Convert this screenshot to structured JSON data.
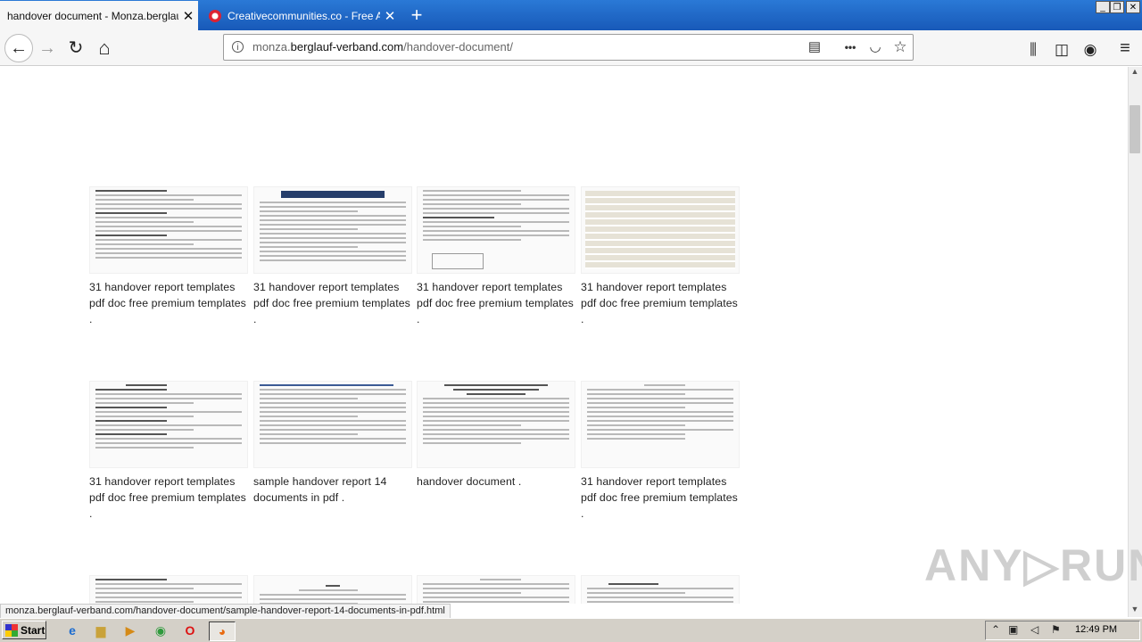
{
  "tabs": [
    {
      "title": "handover document - Monza.berglauf-",
      "close": "✕"
    },
    {
      "title": "Creativecommunities.co - Free All",
      "close": "✕"
    }
  ],
  "new_tab_label": "+",
  "window_controls": [
    "_",
    "❐",
    "✕"
  ],
  "nav": {
    "back": "←",
    "forward": "→",
    "reload": "↻",
    "home": "⌂"
  },
  "url": {
    "prefix": "monza.",
    "host": "berglauf-verband.com",
    "path": "/handover-document/"
  },
  "url_icons": {
    "reader": "▤",
    "more": "•••",
    "pocket": "◡",
    "bookmark": "☆"
  },
  "toolbar_icons": {
    "library": "⫼",
    "sidebar": "◫",
    "account": "◉",
    "menu": "≡"
  },
  "cards": [
    {
      "caption": "31 handover report templates pdf doc free premium templates ."
    },
    {
      "caption": "31 handover report templates pdf doc free premium templates ."
    },
    {
      "caption": "31 handover report templates pdf doc free premium templates ."
    },
    {
      "caption": "31 handover report templates pdf doc free premium templates ."
    },
    {
      "caption": "31 handover report templates pdf doc free premium templates ."
    },
    {
      "caption": "sample handover report 14 documents in pdf ."
    },
    {
      "caption": "handover document ."
    },
    {
      "caption": "31 handover report templates pdf doc free premium templates ."
    }
  ],
  "status_url": "monza.berglauf-verband.com/handover-document/sample-handover-report-14-documents-in-pdf.html",
  "watermark": "ANY▷RUN",
  "taskbar": {
    "start": "Start",
    "clock": "12:49 PM"
  },
  "colors": {
    "tabstrip": "#1859b8",
    "accent_red": "#d23"
  }
}
